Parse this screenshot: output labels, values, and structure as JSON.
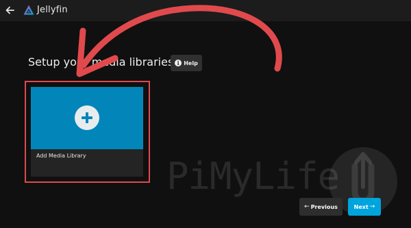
{
  "app": {
    "brand": "Jellyfin"
  },
  "page": {
    "title": "Setup your media libraries",
    "help_label": "Help"
  },
  "library_card": {
    "label": "Add Media Library"
  },
  "footer": {
    "previous_label": "Previous",
    "next_label": "Next"
  },
  "watermark": {
    "text": "PiMyLife",
    "logo_text": "Up"
  },
  "icons": {
    "back": "back-arrow-icon",
    "logo": "jellyfin-logo-icon",
    "help": "info-icon",
    "add": "plus-icon",
    "previous": "arrow-left-icon",
    "next": "arrow-right-icon"
  },
  "colors": {
    "accent": "#00a4dc",
    "card_image": "#0286b9",
    "annotation": "#e04a4d",
    "background": "#101010",
    "header": "#1c1c1c"
  }
}
